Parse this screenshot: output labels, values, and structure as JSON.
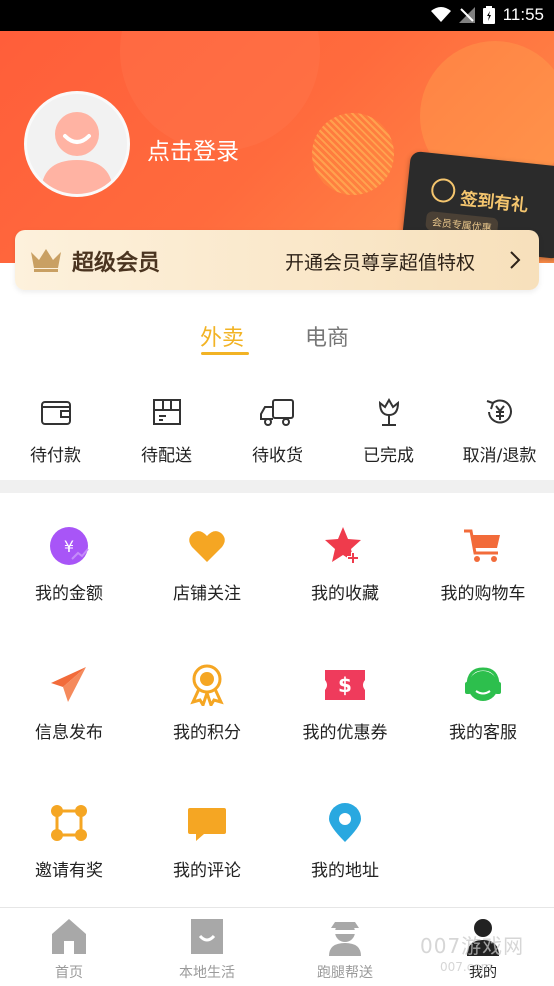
{
  "status_bar": {
    "time": "11:55"
  },
  "header": {
    "login_text": "点击登录",
    "checkin_label": "签到有礼",
    "checkin_sub": "会员专属优惠"
  },
  "vip": {
    "title": "超级会员",
    "desc": "开通会员尊享超值特权"
  },
  "tabs": [
    {
      "label": "外卖",
      "active": true
    },
    {
      "label": "电商",
      "active": false
    }
  ],
  "orders": [
    {
      "label": "待付款",
      "icon": "wallet-icon"
    },
    {
      "label": "待配送",
      "icon": "package-icon"
    },
    {
      "label": "待收货",
      "icon": "truck-icon"
    },
    {
      "label": "已完成",
      "icon": "flower-icon"
    },
    {
      "label": "取消/退款",
      "icon": "refund-icon"
    }
  ],
  "grid": [
    {
      "label": "我的金额",
      "icon": "money-icon",
      "color": "#a855f7"
    },
    {
      "label": "店铺关注",
      "icon": "heart-icon",
      "color": "#f5a623"
    },
    {
      "label": "我的收藏",
      "icon": "star-add-icon",
      "color": "#ef3b4c"
    },
    {
      "label": "我的购物车",
      "icon": "cart-icon",
      "color": "#f26b3a"
    },
    {
      "label": "信息发布",
      "icon": "paper-plane-icon",
      "color": "#f26b3a"
    },
    {
      "label": "我的积分",
      "icon": "medal-icon",
      "color": "#f5a623"
    },
    {
      "label": "我的优惠券",
      "icon": "coupon-icon",
      "color": "#ef3b5c"
    },
    {
      "label": "我的客服",
      "icon": "headset-icon",
      "color": "#2dbf4d"
    },
    {
      "label": "邀请有奖",
      "icon": "network-icon",
      "color": "#f5a623"
    },
    {
      "label": "我的评论",
      "icon": "comment-icon",
      "color": "#f5a623"
    },
    {
      "label": "我的地址",
      "icon": "location-icon",
      "color": "#29a8e0"
    }
  ],
  "bottom_nav": [
    {
      "label": "首页",
      "icon": "home-icon"
    },
    {
      "label": "本地生活",
      "icon": "bag-icon"
    },
    {
      "label": "跑腿帮送",
      "icon": "courier-icon"
    },
    {
      "label": "我的",
      "icon": "user-icon"
    }
  ],
  "watermark": {
    "text": "007游戏网",
    "sub": "007.com"
  }
}
